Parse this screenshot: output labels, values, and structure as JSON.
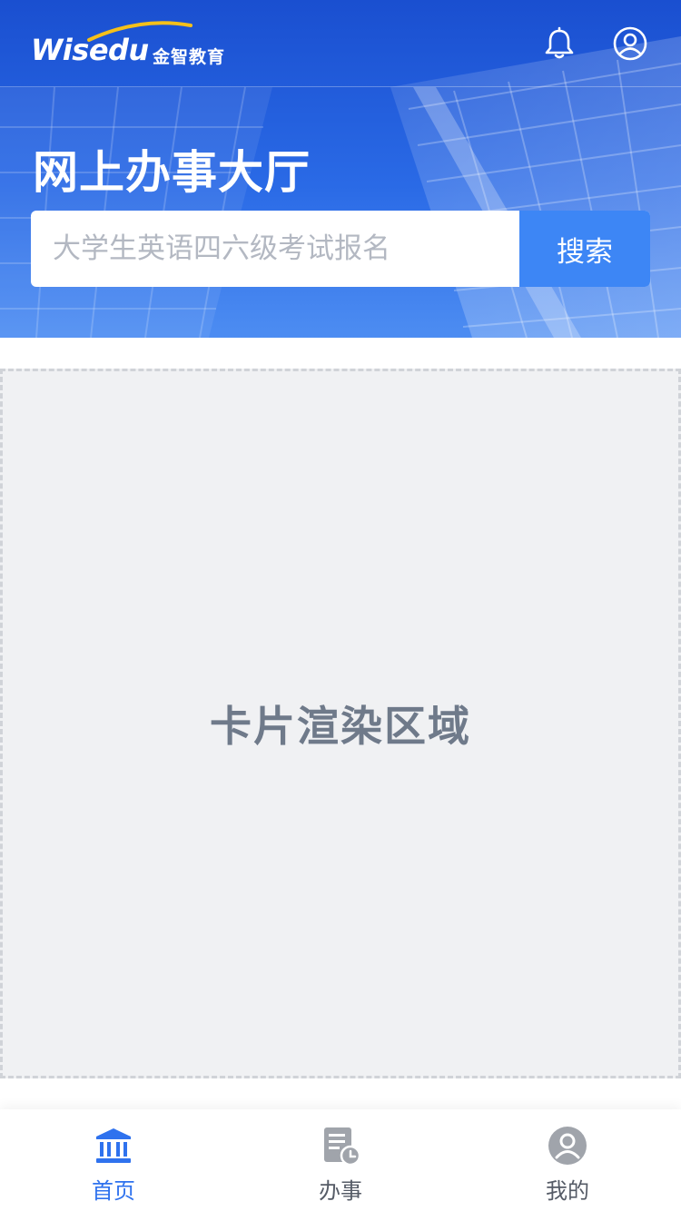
{
  "header": {
    "logo_text": "Wisedu",
    "logo_cn": "金智教育",
    "title": "网上办事大厅",
    "bell_icon": "bell-icon",
    "profile_icon": "user-circle-icon"
  },
  "search": {
    "placeholder": "大学生英语四六级考试报名",
    "button_label": "搜索"
  },
  "main": {
    "card_area_label": "卡片渲染区域"
  },
  "tabbar": {
    "items": [
      {
        "label": "首页",
        "icon": "bank-icon",
        "active": true
      },
      {
        "label": "办事",
        "icon": "document-clock-icon",
        "active": false
      },
      {
        "label": "我的",
        "icon": "user-avatar-icon",
        "active": false
      }
    ]
  },
  "colors": {
    "accent": "#3d86f5",
    "banner": "#2a6ae6",
    "tab_active": "#2f72ee",
    "tab_inactive": "#a0a4ab"
  }
}
